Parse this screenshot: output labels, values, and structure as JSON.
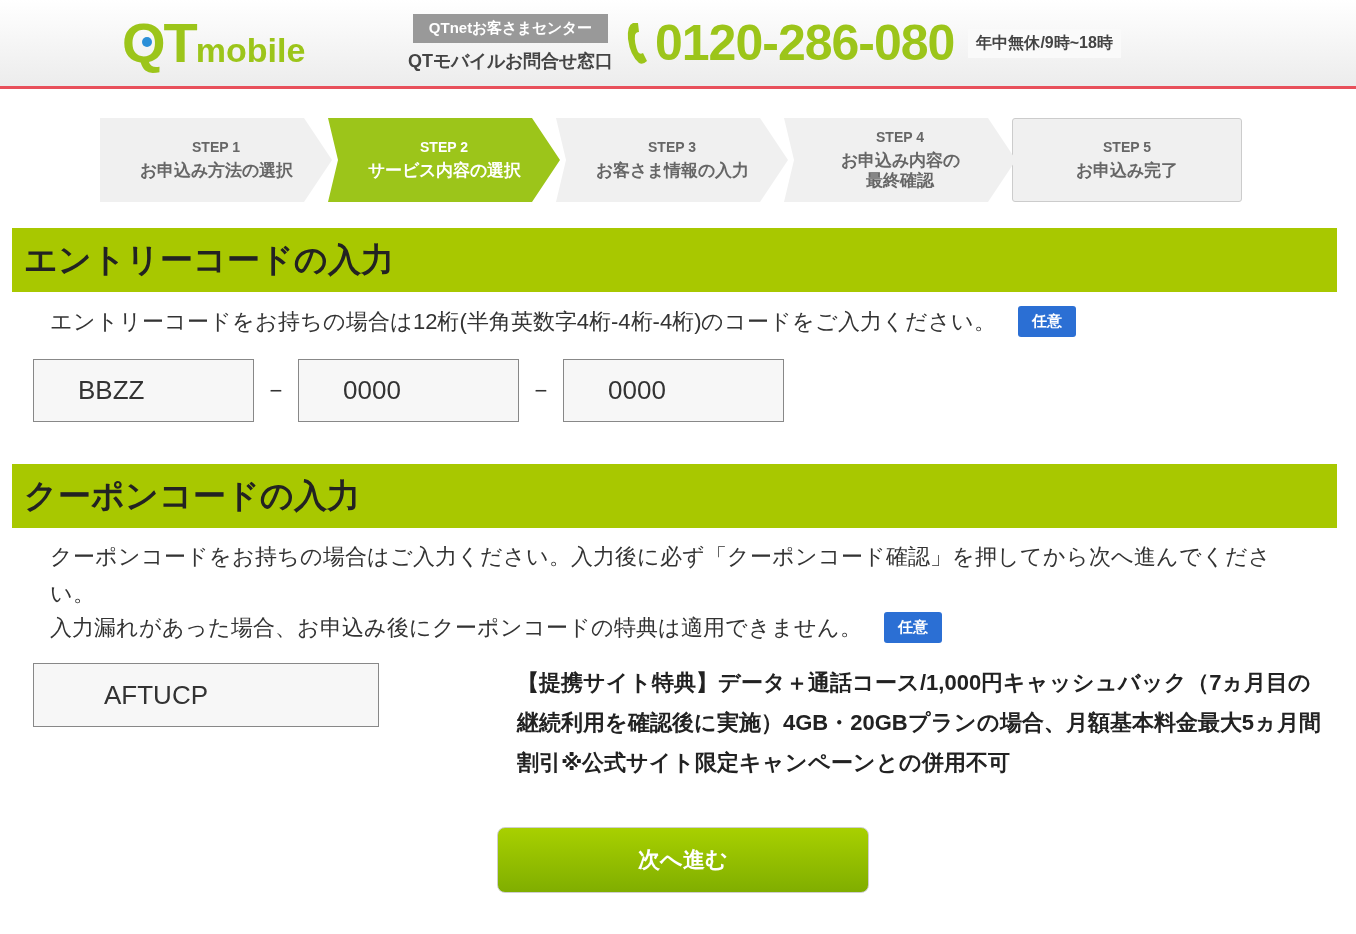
{
  "header": {
    "logo": {
      "main": "QT",
      "sub": "mobile"
    },
    "center_label": "QTnetお客さまセンター",
    "center_name": "QTモバイルお問合せ窓口",
    "phone": "0120-286-080",
    "hours": "年中無休/9時~18時"
  },
  "steps": [
    {
      "step": "STEP 1",
      "label_lines": [
        "お申込み方法の選択"
      ],
      "selected": false
    },
    {
      "step": "STEP 2",
      "label_lines": [
        "サービス内容の選択"
      ],
      "selected": true
    },
    {
      "step": "STEP 3",
      "label_lines": [
        "お客さま情報の入力"
      ],
      "selected": false
    },
    {
      "step": "STEP 4",
      "label_lines": [
        "お申込み内容の",
        "最終確認"
      ],
      "selected": false
    },
    {
      "step": "STEP 5",
      "label_lines": [
        "お申込み完了"
      ],
      "selected": false
    }
  ],
  "entry_section": {
    "title": "エントリーコードの入力",
    "description": "エントリーコードをお持ちの場合は12桁(半角英数字4桁-4桁-4桁)のコードをご入力ください。",
    "badge": "任意",
    "fields": [
      {
        "value": "BBZZ"
      },
      {
        "value": "0000"
      },
      {
        "value": "0000"
      }
    ],
    "separator": "−"
  },
  "coupon_section": {
    "title": "クーポンコードの入力",
    "description": "クーポンコードをお持ちの場合はご入力ください。入力後に必ず「クーポンコード確認」を押してから次へ進んでください。",
    "note": "入力漏れがあった場合、お申込み後にクーポンコードの特典は適用できません。",
    "badge": "任意",
    "field": {
      "value": "AFTUCP"
    },
    "benefit": "【提携サイト特典】データ＋通話コース/1,000円キャッシュバック（7ヵ月目の継続利用を確認後に実施）4GB・20GBプランの場合、月額基本料金最大5ヵ月間割引※公式サイト限定キャンペーンとの併用不可"
  },
  "next_button": "次へ進む"
}
